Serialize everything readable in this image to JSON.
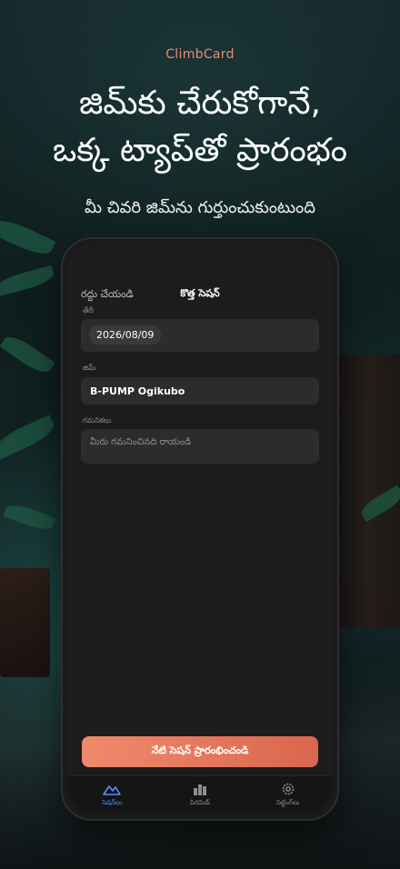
{
  "marketing": {
    "brand": "ClimbCard",
    "headline_line1": "జిమ్‌కు చేరుకోగానే,",
    "headline_line2": "ఒక్క ట్యాప్‌తో ప్రారంభం",
    "subline": "మీ చివరి జిమ్‌ను గుర్తుంచుకుంటుంది"
  },
  "screen": {
    "nav": {
      "cancel_label": "రద్దు చేయండి",
      "title": "కొత్త సెషన్"
    },
    "form": {
      "date_label": "తేదీ",
      "date_value": "2026/08/09",
      "gym_label": "జిమ్",
      "gym_value": "B-PUMP Ogikubo",
      "notes_label": "గమనికలు",
      "notes_placeholder": "మీరు గమనించినది రాయండి"
    },
    "cta_label": "నేటి సెషన్ ప్రారంభించండి",
    "tabs": [
      {
        "label": "సెషన్‌లు",
        "icon": "mountain-icon",
        "active": true
      },
      {
        "label": "పిరమిడ్",
        "icon": "bar-chart-icon",
        "active": false
      },
      {
        "label": "సెట్టింగ్‌లు",
        "icon": "gear-icon",
        "active": false
      }
    ]
  },
  "colors": {
    "accent": "#e98a72",
    "cta_start": "#f08a6c",
    "cta_end": "#d9664d",
    "active_tab": "#5a8cff"
  }
}
